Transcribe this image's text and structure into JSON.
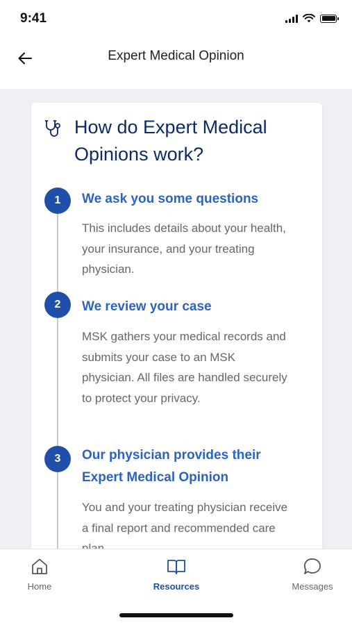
{
  "status_bar": {
    "time": "9:41"
  },
  "header": {
    "title": "Expert Medical Opinion"
  },
  "card": {
    "icon": "stethoscope-icon",
    "title": "How do Expert Medical Opinions work?",
    "steps": [
      {
        "number": "1",
        "title": "We ask you some questions",
        "body": "This includes details about your health, your insurance, and your treating physician."
      },
      {
        "number": "2",
        "title": "We review your case",
        "body": "MSK gathers your medical records and submits your case to an MSK physician. All files are handled securely to protect your privacy."
      },
      {
        "number": "3",
        "title": "Our physician provides their Expert Medical Opinion",
        "body": "You and your treating physician receive a final report and recommended care plan."
      }
    ]
  },
  "tabs": [
    {
      "label": "Home",
      "icon": "home-icon",
      "active": false
    },
    {
      "label": "Resources",
      "icon": "book-icon",
      "active": true
    },
    {
      "label": "Messages",
      "icon": "chat-bubble-icon",
      "active": false
    }
  ],
  "colors": {
    "accent": "#1f4fa8",
    "heading": "#0d2a66",
    "link": "#2c63c0",
    "background": "#eef0f5"
  }
}
